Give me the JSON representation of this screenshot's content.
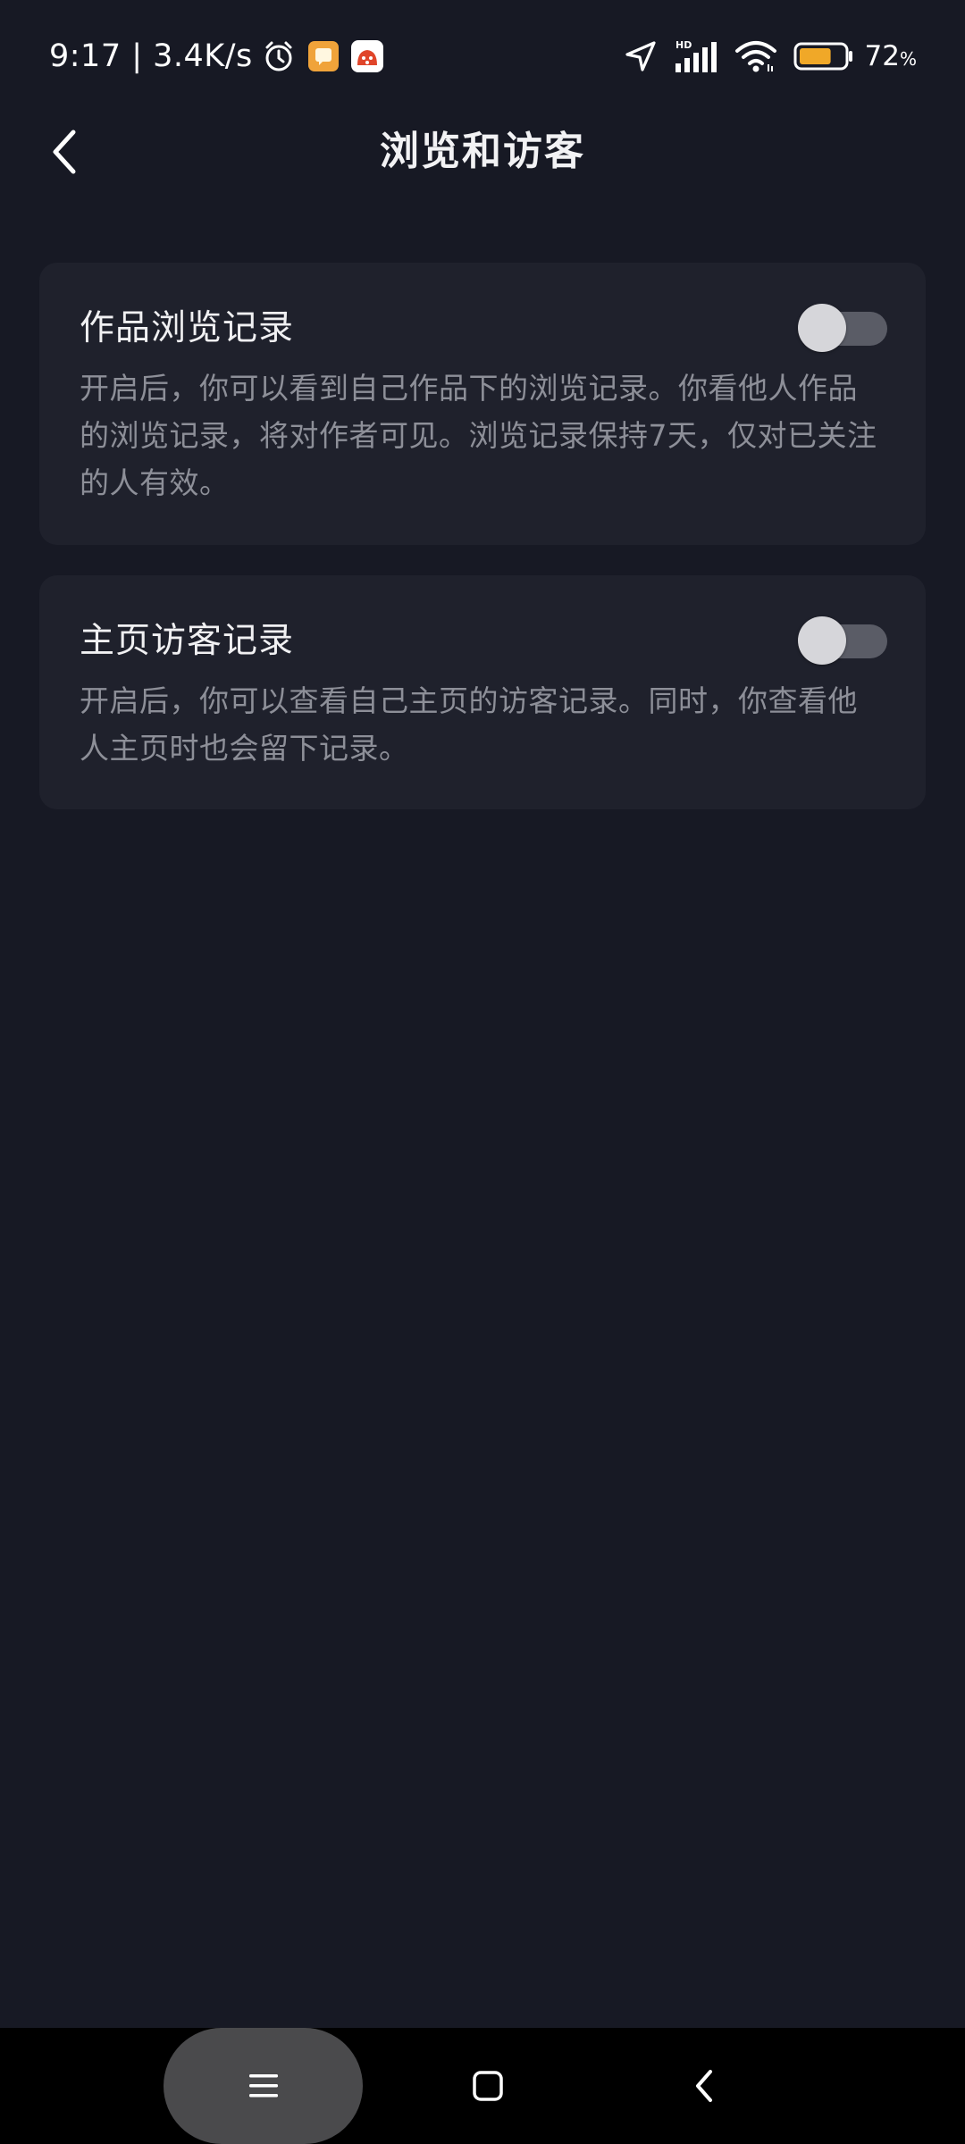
{
  "status_bar": {
    "time_speed": "9:17 | 3.4K/s",
    "battery_level": "72",
    "battery_unit": "%",
    "icons": [
      "alarm-icon",
      "app-notification-icon",
      "app-notification-icon-2",
      "location-icon",
      "hd-signal-icon",
      "wifi-icon",
      "battery-icon"
    ],
    "battery_fill_fraction": 0.72,
    "battery_fill_color": "#f0a828"
  },
  "header": {
    "title": "浏览和访客",
    "back_icon": "chevron-left-icon"
  },
  "settings": [
    {
      "title": "作品浏览记录",
      "description": "开启后，你可以看到自己作品下的浏览记录。你看他人作品的浏览记录，将对作者可见。浏览记录保持7天，仅对已关注的人有效。",
      "enabled": false
    },
    {
      "title": "主页访客记录",
      "description": "开启后，你可以查看自己主页的访客记录。同时，你查看他人主页时也会留下记录。",
      "enabled": false
    }
  ],
  "nav_bar": {
    "icons": [
      "menu-icon",
      "home-square-icon",
      "back-chevron-icon"
    ]
  },
  "colors": {
    "background": "#171924",
    "card": "#1f212c",
    "title_text": "#f0f0f2",
    "description_text": "#8d8f98",
    "toggle_track_off": "#5a5c66",
    "toggle_thumb": "#d6d6da",
    "nav_bar": "#000000"
  }
}
